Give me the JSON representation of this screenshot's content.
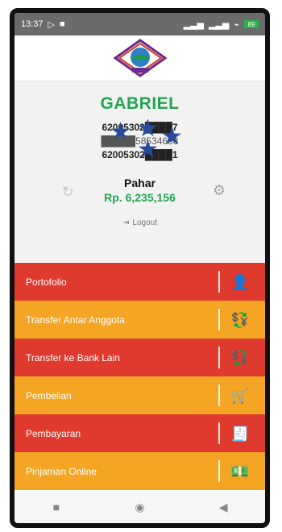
{
  "status_bar": {
    "time": "13:37",
    "left_icons": [
      "play-icon",
      "video-icon"
    ],
    "right_icons": [
      "signal-icon",
      "signal-icon-2",
      "wifi-icon",
      "battery-icon"
    ],
    "battery": "89"
  },
  "header": {
    "logo": "cooperative-logo"
  },
  "profile": {
    "name": "GABRIEL",
    "account_lines": [
      "62005302████7",
      "█████58534698",
      "62005302████1"
    ],
    "balance_label": "Pahar",
    "balance_amount": "Rp. 6,235,156",
    "logout_label": "Logout",
    "refresh_icon": "refresh-icon",
    "settings_icon": "gear-icon"
  },
  "menu": [
    {
      "label": "Portofolio",
      "color": "#e03a2f",
      "icon": "user-icon"
    },
    {
      "label": "Transfer Antar Anggota",
      "color": "#f4a523",
      "icon": "money-transfer-icon"
    },
    {
      "label": "Transfer ke Bank Lain",
      "color": "#e03a2f",
      "icon": "money-transfer-icon"
    },
    {
      "label": "Pembelian",
      "color": "#f4a523",
      "icon": "cart-icon"
    },
    {
      "label": "Pembayaran",
      "color": "#e03a2f",
      "icon": "receipt-icon"
    },
    {
      "label": "Pinjaman Online",
      "color": "#f4a523",
      "icon": "loan-icon"
    }
  ],
  "android_nav": {
    "buttons": [
      "square-button",
      "circle-button",
      "back-button"
    ]
  }
}
